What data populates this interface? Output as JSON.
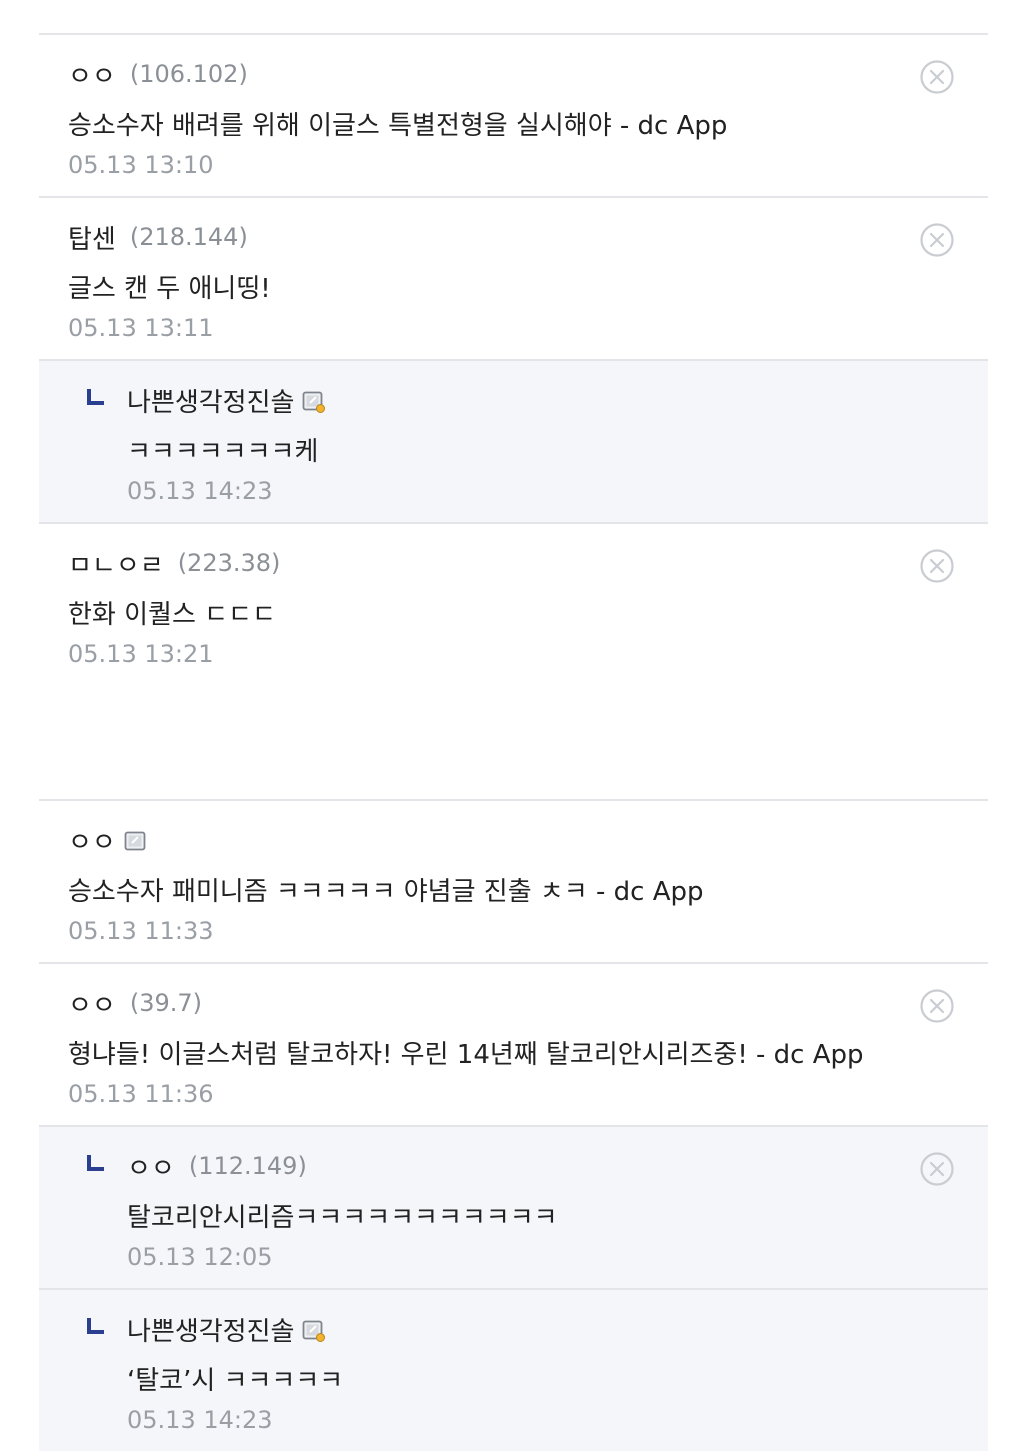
{
  "comments_top": [
    {
      "nick": "ㅇㅇ",
      "ip": "(106.102)",
      "text": "승소수자 배려를 위해 이글스 특별전형을 실시해야 - dc App",
      "date": "05.13 13:10"
    },
    {
      "nick": "탑센",
      "ip": "(218.144)",
      "text": "글스 캔 두 애니띵!",
      "date": "05.13 13:11"
    },
    {
      "nick": "나쁜생각정진솔",
      "text": "ㅋㅋㅋㅋㅋㅋㅋ케",
      "date": "05.13 14:23"
    },
    {
      "nick": "ㅁㄴㅇㄹ",
      "ip": "(223.38)",
      "text": "한화 이퀄스 ㄷㄷㄷ",
      "date": "05.13 13:21"
    }
  ],
  "comments_bottom": [
    {
      "nick": "ㅇㅇ",
      "text": "승소수자 패미니즘 ㅋㅋㅋㅋㅋ 야념글 진출 ㅊㅋ - dc App",
      "date": "05.13 11:33"
    },
    {
      "nick": "ㅇㅇ",
      "ip": "(39.7)",
      "text": "형냐들! 이글스처럼 탈코하자! 우린 14년째 탈코리안시리즈중! - dc App",
      "date": "05.13 11:36"
    },
    {
      "nick": "ㅇㅇ",
      "ip": "(112.149)",
      "text": "탈코리안시리즘ㅋㅋㅋㅋㅋㅋㅋㅋㅋㅋㅋ",
      "date": "05.13 12:05"
    },
    {
      "nick": "나쁜생각정진솔",
      "text": "‘탈코’시 ㅋㅋㅋㅋㅋ",
      "date": "05.13 14:23"
    }
  ],
  "icons": {
    "delete": "circle-x-icon",
    "reply": "reply-arrow-icon",
    "fixed_nick": "fixed-nick-badge-icon",
    "reply_color": "#2a3f8f",
    "delete_color": "#c9ccd1"
  }
}
